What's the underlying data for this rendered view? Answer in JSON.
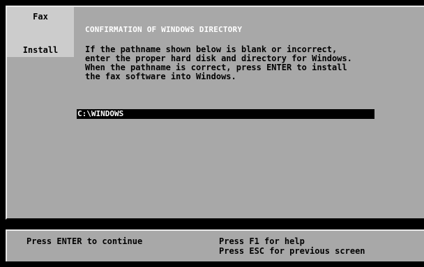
{
  "side_tab": {
    "title": "Fax",
    "subtitle": "Install"
  },
  "main": {
    "heading": "CONFIRMATION OF WINDOWS DIRECTORY",
    "instructions": "If the pathname shown below is blank or incorrect,\nenter the proper hard disk and directory for Windows.\nWhen the pathname is correct, press ENTER to install\nthe fax software into Windows.",
    "path_value": "C:\\WINDOWS"
  },
  "status_bar": {
    "continue_hint": "Press ENTER to continue",
    "help_hint": "Press F1 for help",
    "back_hint": "Press ESC for previous screen"
  },
  "colors": {
    "panel_background": "#a8a8a8",
    "tab_background": "#cccccc",
    "frame_background": "#000000",
    "heading_text": "#ffffff",
    "field_background": "#000000",
    "field_text": "#ffffff"
  }
}
